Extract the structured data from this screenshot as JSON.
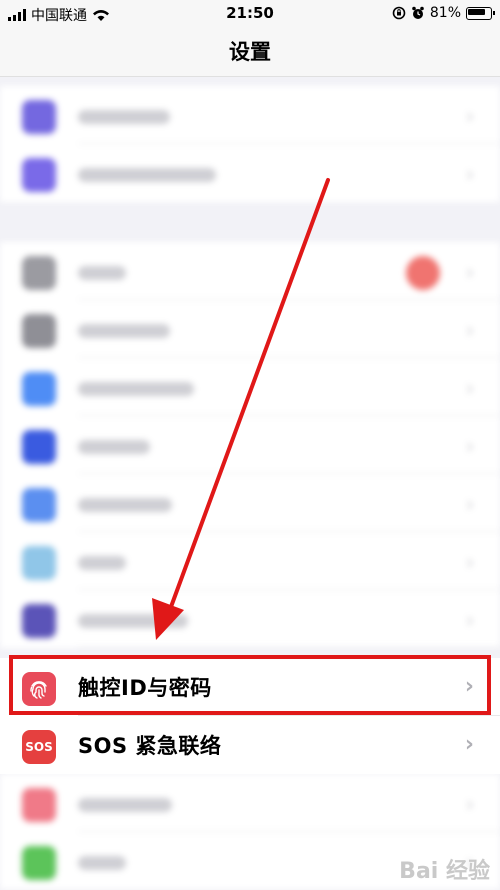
{
  "status_bar": {
    "carrier": "中国联通",
    "time": "21:50",
    "battery": "81%"
  },
  "nav": {
    "title": "设置"
  },
  "rows_group1_colors": [
    "#7468e0",
    "#7a6ae8"
  ],
  "rows_group2_colors": [
    "#9b9ba1",
    "#8f8f96",
    "#4f8df5",
    "#3a5be0",
    "#5b8ff0",
    "#90c6e8",
    "#5b54b8"
  ],
  "touch_id": {
    "label": "触控ID与密码",
    "icon": "fingerprint-icon",
    "color": "#e84b5a"
  },
  "sos": {
    "label": "SOS 紧急联络",
    "icon_text": "SOS",
    "color": "#e5403f"
  },
  "rows_after_colors": [
    "#f07a88",
    "#5cc45a"
  ],
  "accent": "#e01818",
  "watermark": "Bai 经验"
}
